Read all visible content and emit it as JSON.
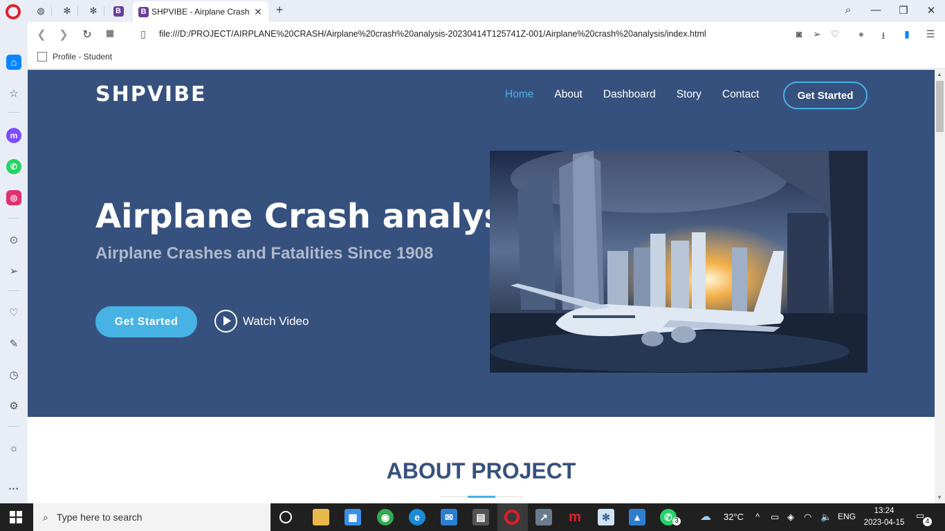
{
  "browser": {
    "tab_title": "SHPVIBE - Airplane Crash",
    "url": "file:///D:/PROJECT/AIRPLANE%20CRASH/Airplane%20crash%20analysis-20230414T125741Z-001/Airplane%20crash%20analysis/index.html",
    "bookmark_label": "Profile - Student",
    "favicon_letter": "B"
  },
  "site": {
    "logo": "SHPVIBE",
    "nav": [
      {
        "label": "Home",
        "active": true
      },
      {
        "label": "About"
      },
      {
        "label": "Dashboard"
      },
      {
        "label": "Story"
      },
      {
        "label": "Contact"
      }
    ],
    "nav_cta": "Get Started",
    "hero_title": "Airplane Crash analysis",
    "hero_subtitle": "Airplane Crashes and Fatalities Since 1908",
    "hero_button": "Get Started",
    "watch_video": "Watch Video",
    "about_title": "ABOUT PROJECT",
    "colors": {
      "hero_bg": "#37517e",
      "accent": "#47b2e4"
    }
  },
  "taskbar": {
    "search_placeholder": "Type here to search",
    "weather": "32°C",
    "language": "ENG",
    "time": "13:24",
    "date": "2023-04-15",
    "notifications": "4",
    "whatsapp_badge": "3"
  }
}
